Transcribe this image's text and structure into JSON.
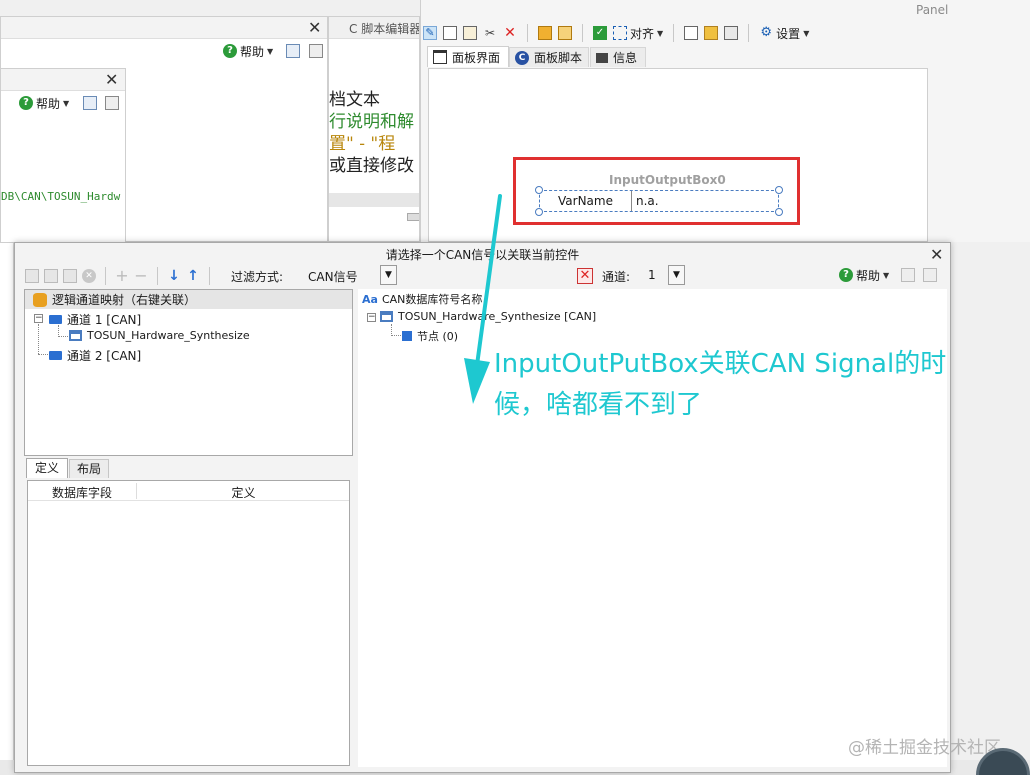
{
  "left_panel_a": {
    "help_label": "帮助",
    "path_text": "DB\\CAN\\TOSUN_Hardw"
  },
  "left_panel_b": {
    "help_label": "帮助"
  },
  "c_editor": {
    "tab_label": "C 脚本编辑器",
    "lines": [
      "档文本",
      "行说明和解",
      "置\" - \"程",
      "或直接修改"
    ]
  },
  "panel": {
    "title": "Panel",
    "toolbar": {
      "align_label": "对齐",
      "settings_label": "设置"
    },
    "tabs": [
      {
        "label": "面板界面"
      },
      {
        "label": "面板脚本"
      },
      {
        "label": "信息"
      }
    ],
    "widget": {
      "name": "InputOutputBox0",
      "var_name": "VarName",
      "value": "n.a."
    }
  },
  "dialog": {
    "title": "请选择一个CAN信号以关联当前控件",
    "filter_label": "过滤方式:",
    "filter_value": "CAN信号",
    "channel_label": "通道:",
    "channel_value": "1",
    "help_label": "帮助",
    "left_tree": {
      "root": "逻辑通道映射（右键关联）",
      "items": [
        {
          "label": "通道 1 [CAN]"
        },
        {
          "label": "TOSUN_Hardware_Synthesize"
        },
        {
          "label": "通道 2 [CAN]"
        }
      ]
    },
    "bottom_tabs": [
      {
        "label": "定义"
      },
      {
        "label": "布局"
      }
    ],
    "grid_headers": [
      "数据库字段",
      "定义"
    ],
    "right_tree": {
      "header": "CAN数据库符号名称",
      "db": "TOSUN_Hardware_Synthesize [CAN]",
      "node": "节点 (0)"
    }
  },
  "annotation": {
    "line1": "InputOutPutBox关联CAN Signal的时",
    "line2": "候，啥都看不到了"
  },
  "watermark": "@稀土掘金技术社区",
  "colors": {
    "accent": "#1ec8d0",
    "highlight": "#e03030",
    "selection": "#cce4f7"
  }
}
